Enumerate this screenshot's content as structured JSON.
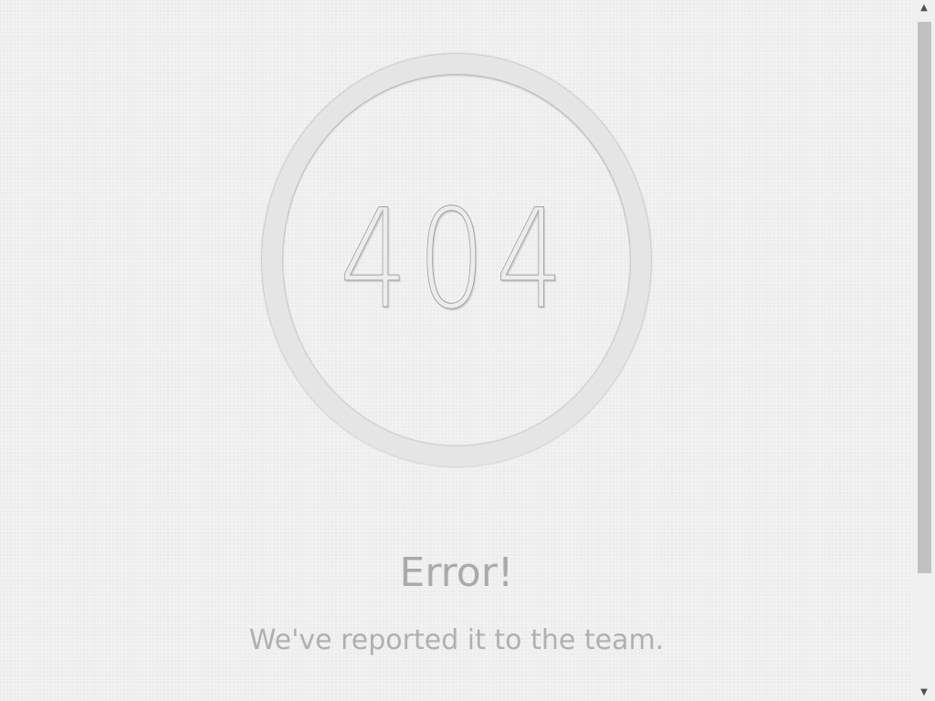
{
  "error_page": {
    "code": "404",
    "title": "Error!",
    "message": "We've reported it to the team."
  },
  "scrollbar": {
    "up_arrow_icon": "▲",
    "down_arrow_icon": "▼",
    "scroll_position": 0
  },
  "colors": {
    "background": "#efefef",
    "ring": "#e5e5e5",
    "text": "#aaaaaa"
  }
}
